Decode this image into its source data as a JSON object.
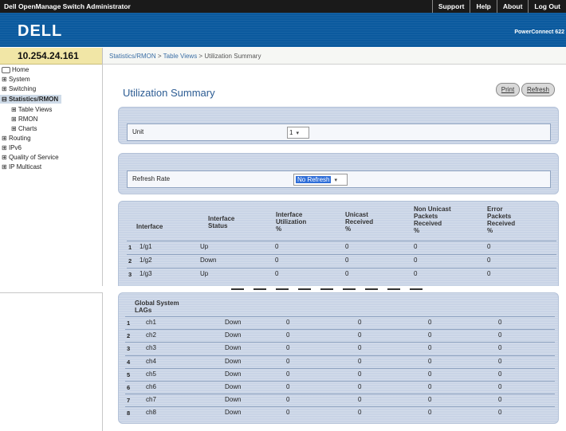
{
  "topbar": {
    "app_title": "Dell OpenManage Switch Administrator",
    "links": [
      "Support",
      "Help",
      "About",
      "Log Out"
    ]
  },
  "banner": {
    "logo": "DELL",
    "product": "PowerConnect 622"
  },
  "ip_address": "10.254.24.161",
  "breadcrumb": {
    "part1": "Statistics/RMON",
    "sep1": " > ",
    "part2": "Table Views",
    "sep2": " > ",
    "current": "Utilization Summary"
  },
  "sidebar": [
    {
      "label": "Home",
      "icon": "home-icon"
    },
    {
      "label": "System",
      "icon": "plus-icon"
    },
    {
      "label": "Switching",
      "icon": "plus-icon"
    },
    {
      "label": "Statistics/RMON",
      "icon": "minus-icon"
    },
    {
      "label": "Table Views",
      "icon": "plus-icon"
    },
    {
      "label": "RMON",
      "icon": "plus-icon"
    },
    {
      "label": "Charts",
      "icon": "plus-icon"
    },
    {
      "label": "Routing",
      "icon": "plus-icon"
    },
    {
      "label": "IPv6",
      "icon": "plus-icon"
    },
    {
      "label": "Quality of Service",
      "icon": "plus-icon"
    },
    {
      "label": "IP Multicast",
      "icon": "plus-icon"
    }
  ],
  "page": {
    "title": "Utilization Summary",
    "print_label": "Print",
    "refresh_label": "Refresh"
  },
  "unit": {
    "label": "Unit",
    "value": "1"
  },
  "refresh_rate": {
    "label": "Refresh Rate",
    "value": "No Refresh"
  },
  "table": {
    "headers": [
      "Interface",
      "Interface\nStatus",
      "Interface\nUtilization\n%",
      "Unicast\nReceived\n%",
      "Non Unicast\nPackets\nReceived\n%",
      "Error\nPackets\nReceived\n%"
    ],
    "rows": [
      {
        "n": "1",
        "iface": "1/g1",
        "status": "Up",
        "util": "0",
        "unicast": "0",
        "nonunicast": "0",
        "error": "0"
      },
      {
        "n": "2",
        "iface": "1/g2",
        "status": "Down",
        "util": "0",
        "unicast": "0",
        "nonunicast": "0",
        "error": "0"
      },
      {
        "n": "3",
        "iface": "1/g3",
        "status": "Up",
        "util": "0",
        "unicast": "0",
        "nonunicast": "0",
        "error": "0"
      }
    ]
  },
  "lags": {
    "header": "Global System\nLAGs",
    "rows": [
      {
        "n": "1",
        "iface": "ch1",
        "status": "Down",
        "util": "0",
        "unicast": "0",
        "nonunicast": "0",
        "error": "0"
      },
      {
        "n": "2",
        "iface": "ch2",
        "status": "Down",
        "util": "0",
        "unicast": "0",
        "nonunicast": "0",
        "error": "0"
      },
      {
        "n": "3",
        "iface": "ch3",
        "status": "Down",
        "util": "0",
        "unicast": "0",
        "nonunicast": "0",
        "error": "0"
      },
      {
        "n": "4",
        "iface": "ch4",
        "status": "Down",
        "util": "0",
        "unicast": "0",
        "nonunicast": "0",
        "error": "0"
      },
      {
        "n": "5",
        "iface": "ch5",
        "status": "Down",
        "util": "0",
        "unicast": "0",
        "nonunicast": "0",
        "error": "0"
      },
      {
        "n": "6",
        "iface": "ch6",
        "status": "Down",
        "util": "0",
        "unicast": "0",
        "nonunicast": "0",
        "error": "0"
      },
      {
        "n": "7",
        "iface": "ch7",
        "status": "Down",
        "util": "0",
        "unicast": "0",
        "nonunicast": "0",
        "error": "0"
      },
      {
        "n": "8",
        "iface": "ch8",
        "status": "Down",
        "util": "0",
        "unicast": "0",
        "nonunicast": "0",
        "error": "0"
      }
    ]
  },
  "colors": {
    "banner": "#0b5a9e",
    "panel": "#c9d4e6",
    "ip_bar": "#f1e6a6",
    "title": "#2c5c93"
  }
}
